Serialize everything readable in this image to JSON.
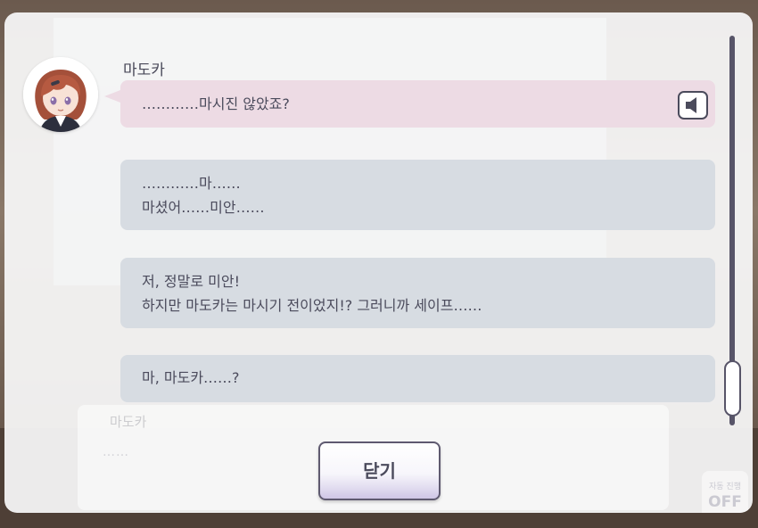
{
  "background": {
    "speaker_name": "마도카",
    "dots": "……",
    "auto_label": "자동 진행",
    "auto_value": "OFF"
  },
  "log": {
    "speaker_name": "마도카",
    "messages": [
      {
        "lines": [
          "…………마시진 않았죠?"
        ],
        "style": "pink",
        "has_voice": true
      },
      {
        "lines": [
          "…………마……",
          "마셨어……미안……"
        ],
        "style": "gray"
      },
      {
        "lines": [
          "저, 정말로 미안!",
          "하지만 마도카는 마시기 전이었지!? 그러니까 세이프……"
        ],
        "style": "gray"
      },
      {
        "lines": [
          "마, 마도카……?"
        ],
        "style": "gray"
      }
    ]
  },
  "close_label": "닫기",
  "icons": {
    "voice": "speaker-icon",
    "avatar": "character-avatar"
  },
  "colors": {
    "pink_bubble": "#eddbe4",
    "gray_bubble": "#d7dce2",
    "text": "#4b4b5c",
    "scrollbar": "#575468"
  }
}
